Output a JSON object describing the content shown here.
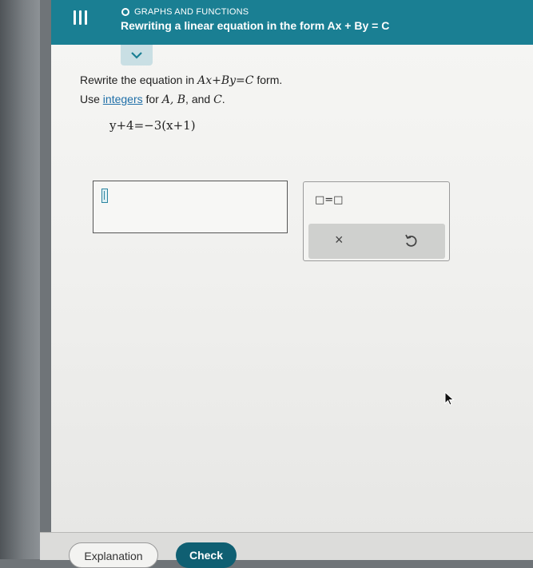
{
  "header": {
    "topic": "GRAPHS AND FUNCTIONS",
    "title": "Rewriting a linear equation in the form Ax + By = C",
    "color": "#1a7f93"
  },
  "question": {
    "line1_prefix": "Rewrite the equation in ",
    "line1_math": "Ax+By=C",
    "line1_suffix": " form.",
    "line2_prefix": "Use ",
    "line2_link": "integers",
    "line2_mid": " for ",
    "line2_vars": "A, B",
    "line2_and": ", and ",
    "line2_last": "C",
    "line2_end": ".",
    "equation": "y+4=−3(x+1)"
  },
  "answer": {
    "value": ""
  },
  "keypad": {
    "template_symbol": "□=□",
    "clear_symbol": "×"
  },
  "footer": {
    "explanation_label": "Explanation",
    "check_label": "Check",
    "check_color": "#0f5f72"
  }
}
